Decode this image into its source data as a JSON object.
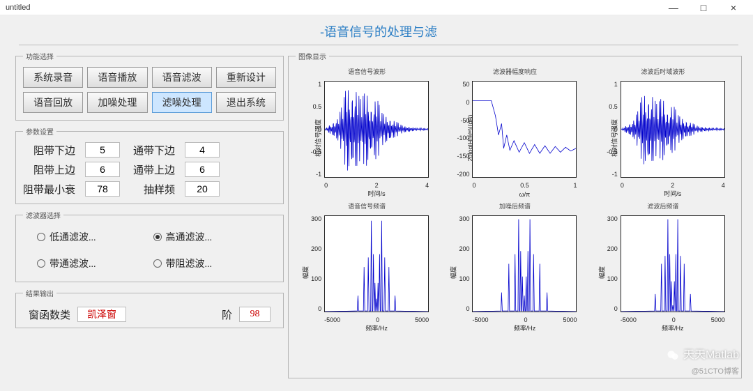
{
  "window": {
    "title": "untitled",
    "min_icon": "—",
    "max_icon": "□",
    "close_icon": "×"
  },
  "header": {
    "title": "-语音信号的处理与滤"
  },
  "func_panel": {
    "legend": "功能选择",
    "buttons": [
      {
        "label": "系统录音",
        "active": false
      },
      {
        "label": "语音播放",
        "active": false
      },
      {
        "label": "语音滤波",
        "active": false
      },
      {
        "label": "重新设计",
        "active": false
      },
      {
        "label": "语音回放",
        "active": false
      },
      {
        "label": "加噪处理",
        "active": false
      },
      {
        "label": "滤噪处理",
        "active": true
      },
      {
        "label": "退出系统",
        "active": false
      }
    ]
  },
  "param_panel": {
    "legend": "参数设置",
    "rows": [
      {
        "l1": "阻带下边",
        "v1": "5",
        "l2": "通带下边",
        "v2": "4"
      },
      {
        "l1": "阻带上边",
        "v1": "6",
        "l2": "通带上边",
        "v2": "6"
      },
      {
        "l1": "阻带最小衰",
        "v1": "78",
        "l2": "抽样频",
        "v2": "20"
      }
    ]
  },
  "filter_panel": {
    "legend": "滤波器选择",
    "options": [
      {
        "label": "低通滤波...",
        "checked": false
      },
      {
        "label": "高通滤波...",
        "checked": true
      },
      {
        "label": "带通滤波...",
        "checked": false
      },
      {
        "label": "带阻滤波...",
        "checked": false
      }
    ]
  },
  "result_panel": {
    "legend": "结果输出",
    "win_label": "窗函数类",
    "win_value": "凯泽窗",
    "order_label": "阶",
    "order_value": "98"
  },
  "image_panel": {
    "legend": "图像显示"
  },
  "charts": [
    {
      "title": "语音信号波形",
      "xlabel": "时间/s",
      "ylabel": "相对信号强度",
      "yticks": [
        "1",
        "0.5",
        "0",
        "-0.5",
        "-1"
      ],
      "xticks": [
        "0",
        "2",
        "4"
      ],
      "shape": "audio",
      "data": {
        "xlim": [
          0,
          4
        ],
        "ylim": [
          -1,
          1
        ],
        "env": [
          [
            0,
            0
          ],
          [
            0.1,
            0.05
          ],
          [
            0.3,
            0.15
          ],
          [
            0.5,
            0.25
          ],
          [
            0.7,
            0.55
          ],
          [
            0.85,
            0.95
          ],
          [
            1.0,
            0.8
          ],
          [
            1.2,
            0.9
          ],
          [
            1.4,
            0.6
          ],
          [
            1.6,
            0.85
          ],
          [
            1.8,
            0.5
          ],
          [
            2.0,
            0.7
          ],
          [
            2.2,
            0.35
          ],
          [
            2.5,
            0.25
          ],
          [
            3.0,
            0.08
          ],
          [
            3.5,
            0.03
          ],
          [
            4.0,
            0.02
          ]
        ]
      }
    },
    {
      "title": "滤波器幅度响应",
      "xlabel": "ω/π",
      "ylabel": "20log|H(eʲʷ)|(dB)",
      "yticks": [
        "50",
        "0",
        "-50",
        "-100",
        "-150",
        "-200"
      ],
      "xticks": [
        "0",
        "0.5",
        "1"
      ],
      "shape": "magresp",
      "data": {
        "xlim": [
          0,
          1
        ],
        "ylim": [
          -200,
          50
        ],
        "points": [
          [
            0,
            0
          ],
          [
            0.1,
            0
          ],
          [
            0.18,
            0
          ],
          [
            0.22,
            -40
          ],
          [
            0.25,
            -90
          ],
          [
            0.28,
            -60
          ],
          [
            0.3,
            -125
          ],
          [
            0.33,
            -90
          ],
          [
            0.36,
            -130
          ],
          [
            0.4,
            -105
          ],
          [
            0.45,
            -135
          ],
          [
            0.5,
            -110
          ],
          [
            0.55,
            -138
          ],
          [
            0.6,
            -115
          ],
          [
            0.65,
            -138
          ],
          [
            0.7,
            -118
          ],
          [
            0.75,
            -138
          ],
          [
            0.8,
            -120
          ],
          [
            0.85,
            -135
          ],
          [
            0.9,
            -122
          ],
          [
            0.95,
            -132
          ],
          [
            1.0,
            -125
          ]
        ]
      }
    },
    {
      "title": "滤波后时域波形",
      "xlabel": "时间/s",
      "ylabel": "相对信号强度",
      "yticks": [
        "1",
        "0.5",
        "0",
        "-0.5",
        "-1"
      ],
      "xticks": [
        "0",
        "2",
        "4"
      ],
      "shape": "audio",
      "data": {
        "xlim": [
          0,
          4
        ],
        "ylim": [
          -1,
          1
        ],
        "env": [
          [
            0,
            0
          ],
          [
            0.1,
            0.04
          ],
          [
            0.3,
            0.12
          ],
          [
            0.5,
            0.22
          ],
          [
            0.7,
            0.45
          ],
          [
            0.85,
            0.8
          ],
          [
            1.0,
            0.7
          ],
          [
            1.2,
            0.78
          ],
          [
            1.4,
            0.5
          ],
          [
            1.6,
            0.72
          ],
          [
            1.8,
            0.42
          ],
          [
            2.0,
            0.55
          ],
          [
            2.2,
            0.3
          ],
          [
            2.5,
            0.2
          ],
          [
            3.0,
            0.06
          ],
          [
            3.5,
            0.03
          ],
          [
            4.0,
            0.02
          ]
        ]
      }
    },
    {
      "title": "语音信号频谱",
      "xlabel": "频率/Hz",
      "ylabel": "幅度",
      "yticks": [
        "300",
        "200",
        "100",
        "0"
      ],
      "xticks": [
        "-5000",
        "0",
        "5000"
      ],
      "shape": "spectrum",
      "data": {
        "xlim": [
          -5000,
          5000
        ],
        "ylim": [
          0,
          300
        ],
        "peaks": [
          [
            -1800,
            50
          ],
          [
            -1200,
            140
          ],
          [
            -800,
            170
          ],
          [
            -500,
            285
          ],
          [
            -300,
            180
          ],
          [
            -150,
            90
          ],
          [
            0,
            40
          ],
          [
            150,
            90
          ],
          [
            300,
            180
          ],
          [
            500,
            285
          ],
          [
            800,
            170
          ],
          [
            1200,
            140
          ],
          [
            1800,
            50
          ]
        ]
      }
    },
    {
      "title": "加噪后频谱",
      "xlabel": "频率/Hz",
      "ylabel": "幅度",
      "yticks": [
        "300",
        "200",
        "100",
        "0"
      ],
      "xticks": [
        "-5000",
        "0",
        "5000"
      ],
      "shape": "spectrum",
      "data": {
        "xlim": [
          -5000,
          5000
        ],
        "ylim": [
          0,
          300
        ],
        "peaks": [
          [
            -2200,
            60
          ],
          [
            -1500,
            150
          ],
          [
            -900,
            180
          ],
          [
            -550,
            290
          ],
          [
            -350,
            190
          ],
          [
            -180,
            110
          ],
          [
            0,
            50
          ],
          [
            180,
            110
          ],
          [
            350,
            190
          ],
          [
            550,
            290
          ],
          [
            900,
            180
          ],
          [
            1500,
            150
          ],
          [
            2200,
            60
          ]
        ]
      }
    },
    {
      "title": "滤波后频谱",
      "xlabel": "频率/Hz",
      "ylabel": "幅度",
      "yticks": [
        "300",
        "200",
        "100",
        "0"
      ],
      "xticks": [
        "-5000",
        "0",
        "5000"
      ],
      "shape": "spectrum",
      "data": {
        "xlim": [
          -5000,
          5000
        ],
        "ylim": [
          0,
          300
        ],
        "peaks": [
          [
            -1700,
            55
          ],
          [
            -1100,
            150
          ],
          [
            -750,
            175
          ],
          [
            -480,
            290
          ],
          [
            -300,
            180
          ],
          [
            -150,
            95
          ],
          [
            0,
            20
          ],
          [
            150,
            95
          ],
          [
            300,
            180
          ],
          [
            480,
            290
          ],
          [
            750,
            175
          ],
          [
            1100,
            150
          ],
          [
            1700,
            55
          ]
        ]
      }
    }
  ],
  "watermark": {
    "brand": "天天Matlab",
    "sub": "@51CTO博客"
  }
}
